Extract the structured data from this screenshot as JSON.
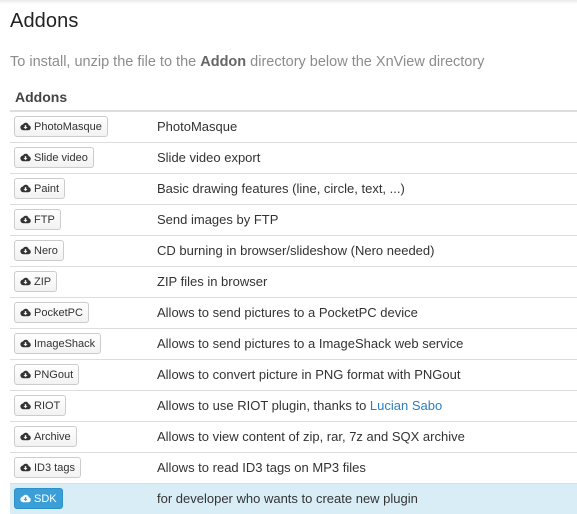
{
  "page": {
    "title": "Addons",
    "hint_before": "To install, unzip the file to the ",
    "hint_bold": "Addon",
    "hint_after": " directory below the XnView directory",
    "table_header": "Addons"
  },
  "addons": [
    {
      "button": "PhotoMasque",
      "desc": "PhotoMasque"
    },
    {
      "button": "Slide video",
      "desc": "Slide video export"
    },
    {
      "button": "Paint",
      "desc": "Basic drawing features (line, circle, text, ...)"
    },
    {
      "button": "FTP",
      "desc": "Send images by FTP"
    },
    {
      "button": "Nero",
      "desc": "CD burning in browser/slideshow (Nero needed)"
    },
    {
      "button": "ZIP",
      "desc": "ZIP files in browser"
    },
    {
      "button": "PocketPC",
      "desc": "Allows to send pictures to a PocketPC device"
    },
    {
      "button": "ImageShack",
      "desc": "Allows to send pictures to a ImageShack web service"
    },
    {
      "button": "PNGout",
      "desc": "Allows to convert picture in PNG format with PNGout"
    },
    {
      "button": "RIOT",
      "desc": "Allows to use RIOT plugin, thanks to ",
      "link": "Lucian Sabo"
    },
    {
      "button": "Archive",
      "desc": "Allows to view content of zip, rar, 7z and SQX archive"
    },
    {
      "button": "ID3 tags",
      "desc": "Allows to read ID3 tags on MP3 files"
    },
    {
      "button": "SDK",
      "desc": "for developer who wants to create new plugin",
      "highlighted": true
    }
  ],
  "icons": {
    "download": "cloud-download-icon"
  },
  "colors": {
    "highlight_row": "#d9edf7",
    "primary_button": "#3a9fd8",
    "link": "#2a7fc0"
  }
}
